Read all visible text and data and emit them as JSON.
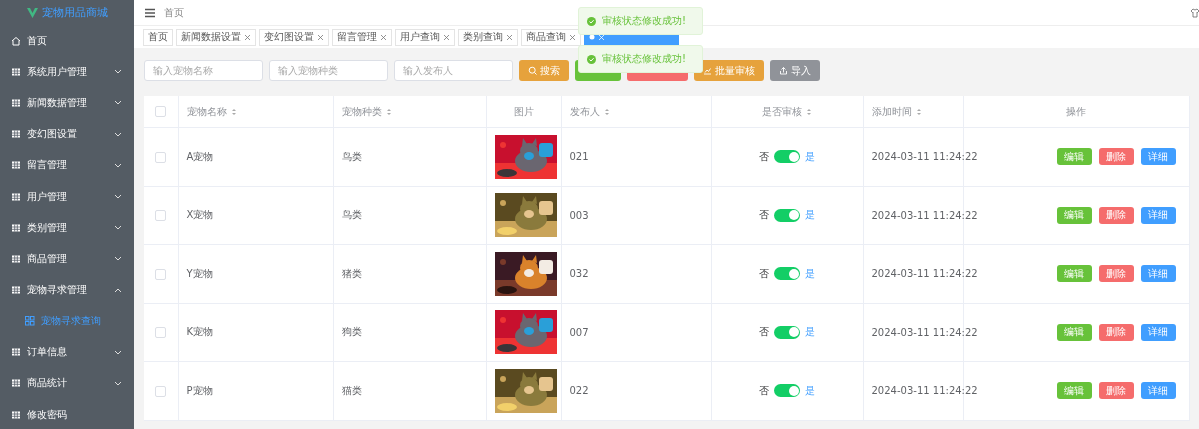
{
  "sidebar": {
    "logo": "宠物用品商城",
    "items": [
      {
        "label": "首页",
        "kind": "home"
      },
      {
        "label": "系统用户管理",
        "kind": "submenu",
        "expanded": false
      },
      {
        "label": "新闻数据管理",
        "kind": "submenu",
        "expanded": false
      },
      {
        "label": "变幻图设置",
        "kind": "submenu",
        "expanded": false
      },
      {
        "label": "留言管理",
        "kind": "submenu",
        "expanded": false
      },
      {
        "label": "用户管理",
        "kind": "submenu",
        "expanded": false
      },
      {
        "label": "类别管理",
        "kind": "submenu",
        "expanded": false
      },
      {
        "label": "商品管理",
        "kind": "submenu",
        "expanded": false
      },
      {
        "label": "宠物寻求管理",
        "kind": "submenu",
        "expanded": true,
        "children": [
          {
            "label": "宠物寻求查询",
            "selected": true
          }
        ]
      },
      {
        "label": "订单信息",
        "kind": "submenu",
        "expanded": false
      },
      {
        "label": "商品统计",
        "kind": "submenu",
        "expanded": false
      },
      {
        "label": "修改密码",
        "kind": "link"
      }
    ]
  },
  "breadcrumb": "首页",
  "tabs": [
    {
      "label": "首页",
      "closable": false,
      "selected": false
    },
    {
      "label": "新闻数据设置",
      "closable": true,
      "selected": false
    },
    {
      "label": "变幻图设置",
      "closable": true,
      "selected": false
    },
    {
      "label": "留言管理",
      "closable": true,
      "selected": false
    },
    {
      "label": "用户查询",
      "closable": true,
      "selected": false
    },
    {
      "label": "类别查询",
      "closable": true,
      "selected": false
    },
    {
      "label": "商品查询",
      "closable": true,
      "selected": false
    },
    {
      "closable": true,
      "selected": true
    }
  ],
  "filters": [
    {
      "placeholder": "输入宠物名称"
    },
    {
      "placeholder": "输入宠物种类"
    },
    {
      "placeholder": "输入发布人"
    }
  ],
  "toolbar": [
    {
      "label": "搜索",
      "kind": "warning"
    },
    {
      "kind": "success"
    },
    {
      "kind": "danger"
    },
    {
      "label": "批量审核",
      "kind": "warning"
    },
    {
      "label": "导入",
      "kind": "info"
    }
  ],
  "table": {
    "all_checked": false,
    "columns": [
      {
        "label": "宠物名称",
        "sortable": true
      },
      {
        "label": "宠物种类",
        "sortable": true
      },
      {
        "label": "图片",
        "sortable": false
      },
      {
        "label": "发布人",
        "sortable": true
      },
      {
        "label": "是否审核",
        "sortable": true
      },
      {
        "label": "添加时间",
        "sortable": true
      },
      {
        "label": "操作",
        "sortable": false
      }
    ],
    "rows": [
      {
        "checked": false,
        "name": "A宠物",
        "category": "鸟类",
        "publisher": "021",
        "audit_off": "否",
        "audit_on": "是",
        "audited": true,
        "time": "2024-03-11 11:24:22",
        "actions": [
          "编辑",
          "删除",
          "详细"
        ]
      },
      {
        "checked": false,
        "name": "X宠物",
        "category": "鸟类",
        "publisher": "003",
        "audit_off": "否",
        "audit_on": "是",
        "audited": true,
        "time": "2024-03-11 11:24:22",
        "actions": [
          "编辑",
          "删除",
          "详细"
        ]
      },
      {
        "checked": false,
        "name": "Y宠物",
        "category": "猪类",
        "publisher": "032",
        "audit_off": "否",
        "audit_on": "是",
        "audited": true,
        "time": "2024-03-11 11:24:22",
        "actions": [
          "编辑",
          "删除",
          "详细"
        ]
      },
      {
        "checked": false,
        "name": "K宠物",
        "category": "狗类",
        "publisher": "007",
        "audit_off": "否",
        "audit_on": "是",
        "audited": true,
        "time": "2024-03-11 11:24:22",
        "actions": [
          "编辑",
          "删除",
          "详细"
        ]
      },
      {
        "checked": false,
        "name": "P宠物",
        "category": "猫类",
        "publisher": "022",
        "audit_off": "否",
        "audit_on": "是",
        "audited": true,
        "time": "2024-03-11 11:24:22",
        "actions": [
          "编辑",
          "删除",
          "详细"
        ]
      }
    ]
  },
  "toasts": [
    {
      "text": "审核状态修改成功!"
    },
    {
      "text": "审核状态修改成功!"
    }
  ]
}
